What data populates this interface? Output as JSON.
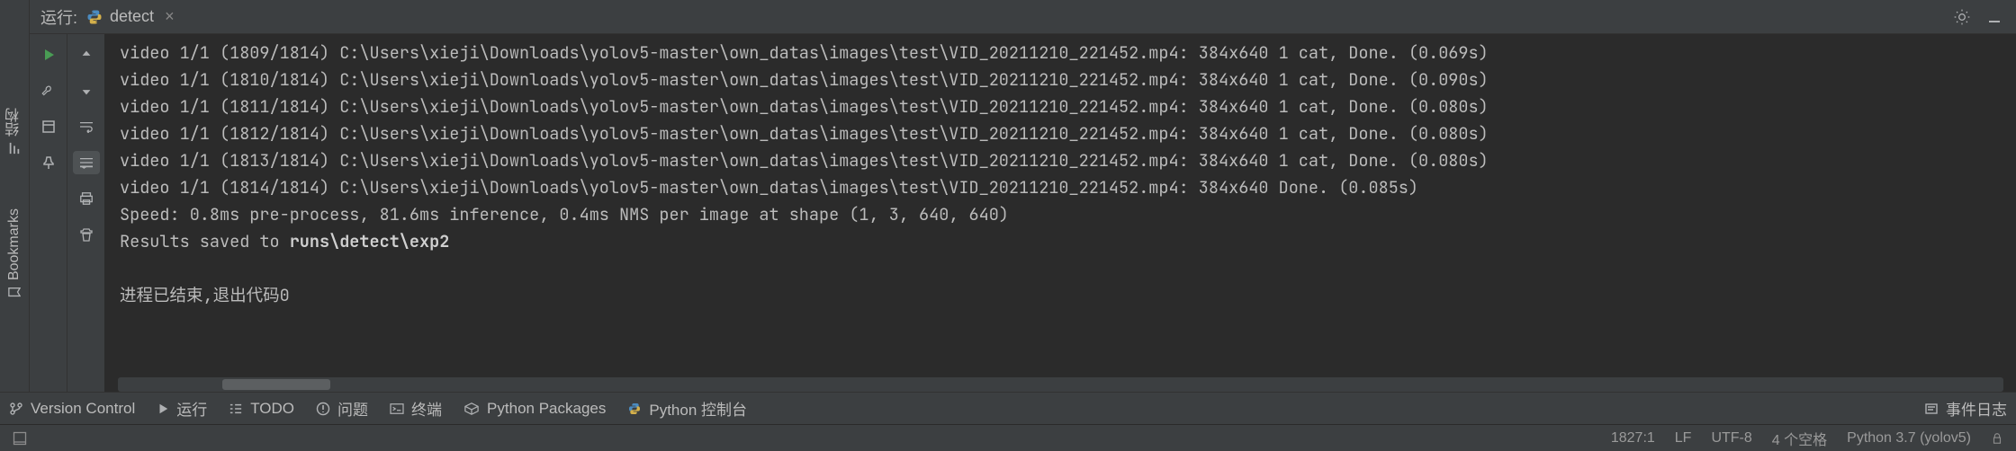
{
  "header": {
    "run_label": "运行:",
    "tab_name": "detect"
  },
  "left_rail": {
    "structure": "结构",
    "bookmarks": "Bookmarks"
  },
  "console": {
    "lines": [
      "video 1/1 (1809/1814) C:\\Users\\xieji\\Downloads\\yolov5-master\\own_datas\\images\\test\\VID_20211210_221452.mp4: 384x640 1 cat, Done. (0.069s)",
      "video 1/1 (1810/1814) C:\\Users\\xieji\\Downloads\\yolov5-master\\own_datas\\images\\test\\VID_20211210_221452.mp4: 384x640 1 cat, Done. (0.090s)",
      "video 1/1 (1811/1814) C:\\Users\\xieji\\Downloads\\yolov5-master\\own_datas\\images\\test\\VID_20211210_221452.mp4: 384x640 1 cat, Done. (0.080s)",
      "video 1/1 (1812/1814) C:\\Users\\xieji\\Downloads\\yolov5-master\\own_datas\\images\\test\\VID_20211210_221452.mp4: 384x640 1 cat, Done. (0.080s)",
      "video 1/1 (1813/1814) C:\\Users\\xieji\\Downloads\\yolov5-master\\own_datas\\images\\test\\VID_20211210_221452.mp4: 384x640 1 cat, Done. (0.080s)",
      "video 1/1 (1814/1814) C:\\Users\\xieji\\Downloads\\yolov5-master\\own_datas\\images\\test\\VID_20211210_221452.mp4: 384x640 Done. (0.085s)",
      "Speed: 0.8ms pre-process, 81.6ms inference, 0.4ms NMS per image at shape (1, 3, 640, 640)"
    ],
    "results_prefix": "Results saved to ",
    "results_path": "runs\\detect\\exp2",
    "finish": "进程已结束,退出代码0"
  },
  "bottom": {
    "version_control": "Version Control",
    "run": "运行",
    "todo": "TODO",
    "problems": "问题",
    "terminal": "终端",
    "py_packages": "Python Packages",
    "py_console": "Python 控制台",
    "event_log": "事件日志"
  },
  "status": {
    "line_col": "1827:1",
    "eol": "LF",
    "encoding": "UTF-8",
    "indent": "4 个空格",
    "interpreter": "Python 3.7 (yolov5)"
  }
}
